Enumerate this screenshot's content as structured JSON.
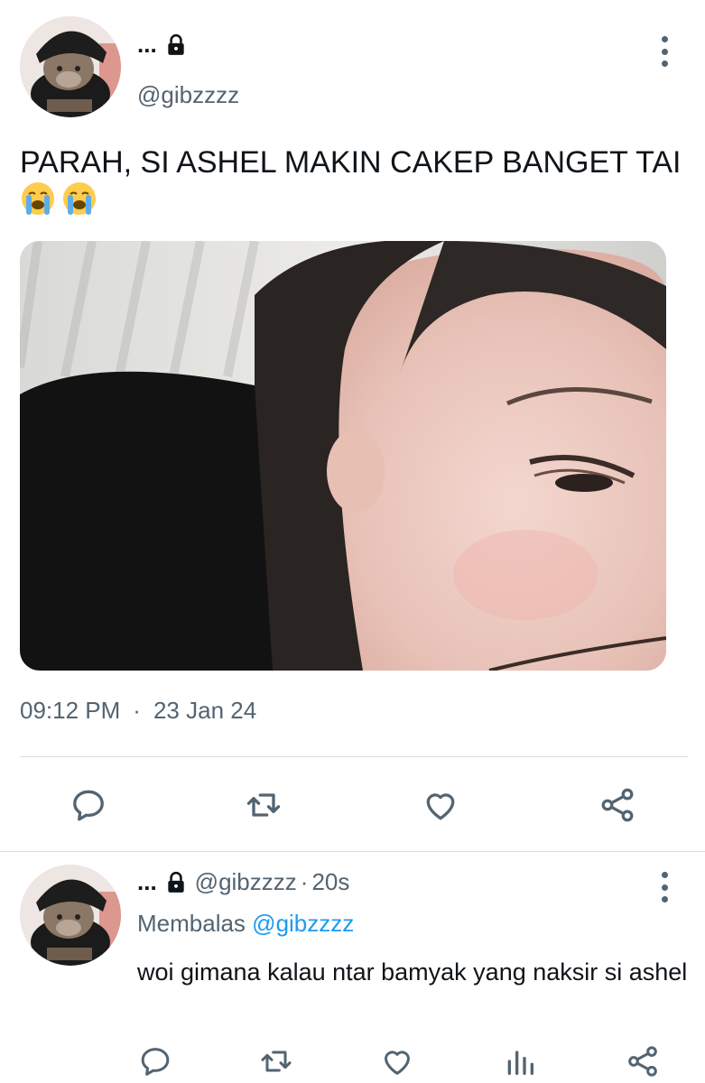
{
  "tweet": {
    "display_name": "...",
    "handle": "@gibzzzz",
    "text": "PARAH, SI ASHEL MAKIN CAKEP BANGET TAI",
    "emojis": [
      "loudly-crying-face",
      "loudly-crying-face"
    ],
    "time": "09:12 PM",
    "separator": "·",
    "date": "23 Jan 24",
    "media_description": "photo"
  },
  "actions": [
    "reply-icon",
    "retweet-icon",
    "like-icon",
    "share-icon"
  ],
  "reply": {
    "display_name": "...",
    "handle": "@gibzzzz",
    "separator": "·",
    "age": "20s",
    "replying_to_label": "Membalas",
    "replying_to_handle": "@gibzzzz",
    "text": "woi gimana kalau ntar bamyak yang naksir si ashel"
  },
  "reply_actions": [
    "reply-icon",
    "retweet-icon",
    "like-icon",
    "views-icon",
    "share-icon"
  ],
  "colors": {
    "text_primary": "#0f1419",
    "text_secondary": "#536471",
    "link": "#1d9bf0",
    "divider": "#d7dde1"
  }
}
